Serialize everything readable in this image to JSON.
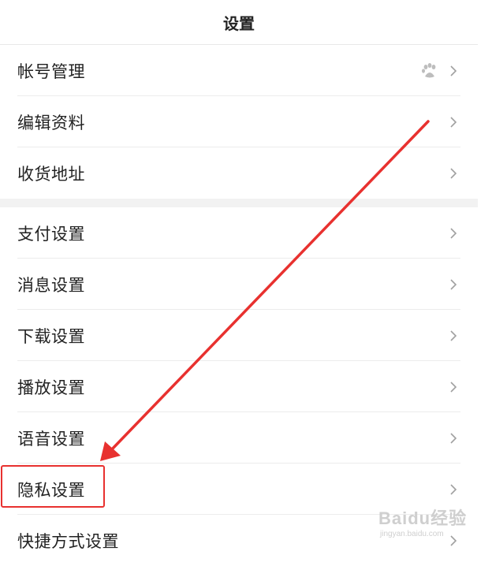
{
  "header": {
    "title": "设置"
  },
  "group1": [
    {
      "label": "帐号管理",
      "has_paw": true
    },
    {
      "label": "编辑资料"
    },
    {
      "label": "收货地址"
    }
  ],
  "group2": [
    {
      "label": "支付设置"
    },
    {
      "label": "消息设置"
    },
    {
      "label": "下载设置"
    },
    {
      "label": "播放设置"
    },
    {
      "label": "语音设置"
    },
    {
      "label": "隐私设置"
    },
    {
      "label": "快捷方式设置"
    }
  ],
  "annotation": {
    "highlight_color": "#e8312f"
  },
  "watermark": {
    "main": "Baidu经验",
    "sub": "jingyan.baidu.com"
  },
  "icons": {
    "chevron": "chevron-right-icon",
    "paw": "baidu-paw-icon"
  }
}
